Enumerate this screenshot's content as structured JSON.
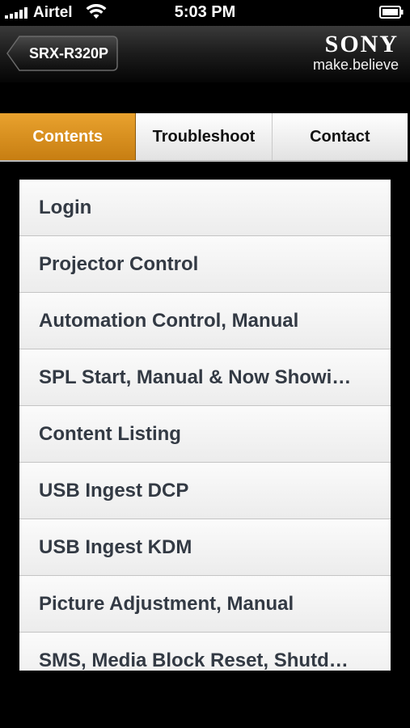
{
  "status_bar": {
    "carrier": "Airtel",
    "time": "5:03 PM"
  },
  "header": {
    "back_label": "SRX-R320P",
    "brand": "SONY",
    "tagline": "make.believe"
  },
  "tabs": [
    {
      "label": "Contents",
      "active": true
    },
    {
      "label": "Troubleshoot",
      "active": false
    },
    {
      "label": "Contact",
      "active": false
    }
  ],
  "list": {
    "items": [
      {
        "label": "Login"
      },
      {
        "label": "Projector Control"
      },
      {
        "label": "Automation Control, Manual"
      },
      {
        "label": "SPL Start, Manual & Now Showi…"
      },
      {
        "label": "Content Listing"
      },
      {
        "label": "USB Ingest DCP"
      },
      {
        "label": "USB Ingest KDM"
      },
      {
        "label": "Picture Adjustment, Manual"
      },
      {
        "label": "SMS, Media Block Reset, Shutd…"
      }
    ]
  },
  "colors": {
    "accent": "#d98f1f",
    "list_text": "#333a44"
  },
  "icons": [
    "signal-icon",
    "wifi-icon",
    "battery-icon",
    "back-arrow-icon"
  ]
}
